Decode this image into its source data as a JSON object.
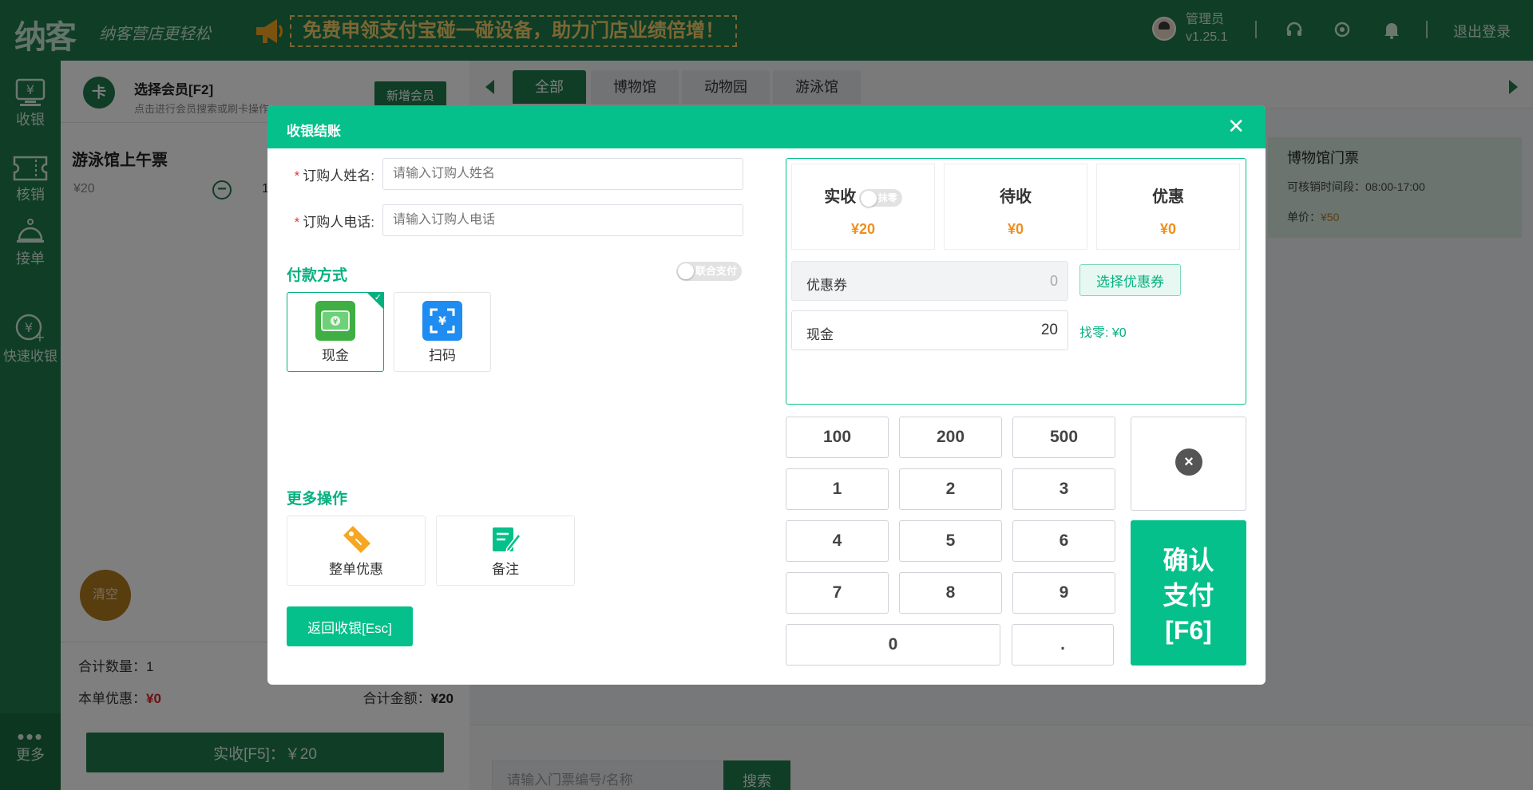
{
  "topbar": {
    "logo": "纳客",
    "slogan": "纳客营店更轻松",
    "promo": "免费申领支付宝碰一碰设备，助力门店业绩倍增！",
    "user_name": "管理员",
    "version": "v1.25.1",
    "logout": "退出登录",
    "icons": [
      "headset-icon",
      "refresh-icon",
      "bell-icon"
    ]
  },
  "sidebar": {
    "items": [
      {
        "label": "收银",
        "icon": "cashier-icon"
      },
      {
        "label": "核销",
        "icon": "ticket-icon"
      },
      {
        "label": "接单",
        "icon": "service-bell-icon"
      },
      {
        "label": "快速收银",
        "icon": "quick-cashier-icon"
      }
    ],
    "more": "更多"
  },
  "left_panel": {
    "member_title": "选择会员[F2]",
    "member_sub": "点击进行会员搜索或刷卡操作",
    "add_member": "新增会员",
    "cart_item": {
      "name": "游泳馆上午票",
      "price": "¥20",
      "qty": "1"
    },
    "clear": "清空",
    "count_label": "合计数量：",
    "count_value": "1",
    "discount_label": "本单优惠：",
    "discount_value": "¥0",
    "amount_label": "合计金额：",
    "amount_value": "¥20",
    "pay_button": "实收[F5]：￥20"
  },
  "right_area": {
    "categories": [
      "全部",
      "博物馆",
      "动物园",
      "游泳馆"
    ],
    "active_category": "全部",
    "ticket_card": {
      "name": "博物馆门票",
      "time": "可核销时间段：08:00-17:00",
      "price_label": "单价：",
      "price_value": "¥50"
    },
    "search_placeholder": "请输入门票编号/名称",
    "search_button": "搜索"
  },
  "modal": {
    "title": "收银结账",
    "close": "✕",
    "buyer_name_label": "订购人姓名:",
    "buyer_name_placeholder": "请输入订购人姓名",
    "buyer_phone_label": "订购人电话:",
    "buyer_phone_placeholder": "请输入订购人电话",
    "payment_title": "付款方式",
    "combined_pay": "联合支付",
    "payment_methods": [
      {
        "label": "现金",
        "icon": "cash-icon",
        "selected": true
      },
      {
        "label": "扫码",
        "icon": "scan-qr-icon",
        "selected": false
      }
    ],
    "more_ops_title": "更多操作",
    "more_ops": [
      {
        "label": "整单优惠",
        "icon": "discount-tag-icon"
      },
      {
        "label": "备注",
        "icon": "note-edit-icon"
      }
    ],
    "back_button": "返回收银[Esc]",
    "summary": {
      "received_label": "实收",
      "round_toggle": "抹零",
      "received_value": "¥20",
      "pending_label": "待收",
      "pending_value": "¥0",
      "discount_label": "优惠",
      "discount_value": "¥0"
    },
    "coupon_label": "优惠券",
    "coupon_value": "0",
    "coupon_button": "选择优惠券",
    "cash_label": "现金",
    "cash_value": "20",
    "change_label": "找零: ¥0",
    "keypad": {
      "quick": [
        "100",
        "200",
        "500"
      ],
      "digits": [
        "1",
        "2",
        "3",
        "4",
        "5",
        "6",
        "7",
        "8",
        "9"
      ],
      "zero": "0",
      "dot": "."
    },
    "delete_key": "×",
    "confirm_button": [
      "确认",
      "支付",
      "[F6]"
    ]
  },
  "colors": {
    "brand_dark": "#1e7a4c",
    "brand_bright": "#05c08a",
    "accent_orange": "#ef8f1e",
    "danger": "#d42424",
    "promo_gold": "#f6cf6b"
  }
}
